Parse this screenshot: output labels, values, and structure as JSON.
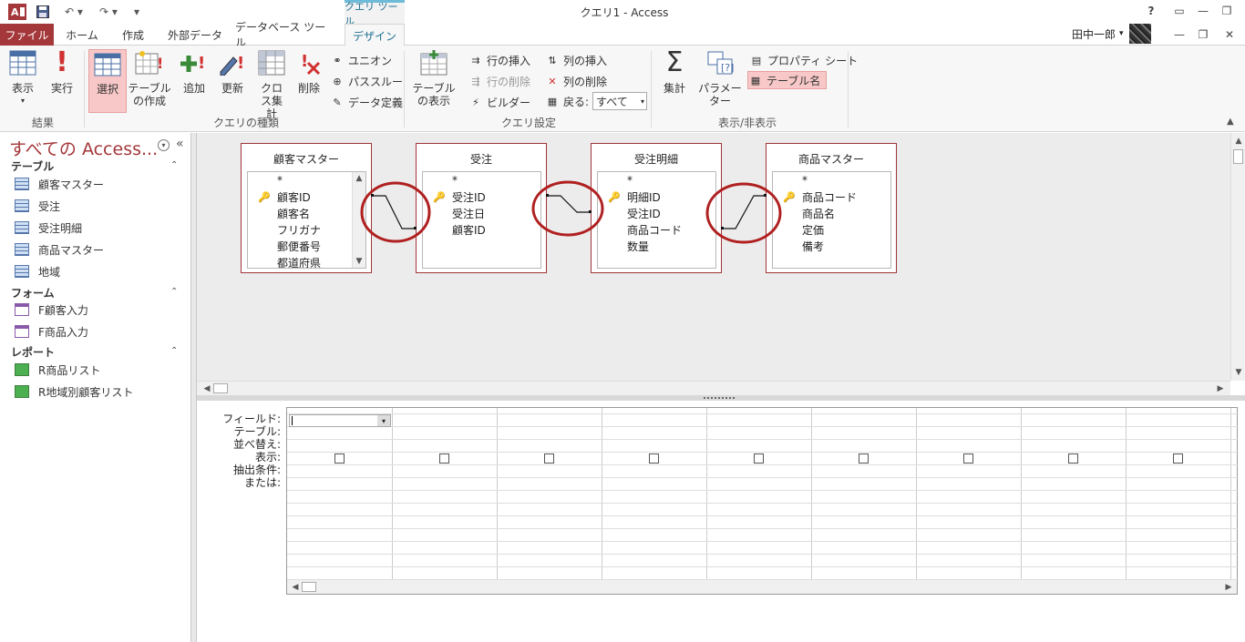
{
  "titlebar": {
    "window_title": "クエリ1 - Access",
    "context_tab_label": "クエリ ツール",
    "help": "?"
  },
  "tabs": [
    "ファイル",
    "ホーム",
    "作成",
    "外部データ",
    "データベース ツール",
    "デザイン"
  ],
  "user": {
    "name": "田中一郎"
  },
  "ribbon": {
    "results": {
      "view": "表示",
      "run": "実行",
      "group": "結果"
    },
    "query_type": {
      "select": "選択",
      "make_table": "テーブルの作成",
      "append": "追加",
      "update": "更新",
      "crosstab": "クロス集計",
      "delete": "削除",
      "union": "ユニオン",
      "passthrough": "パススルー",
      "data_definition": "データ定義",
      "group": "クエリの種類"
    },
    "query_setup": {
      "show_table": "テーブルの表示",
      "insert_rows": "行の挿入",
      "delete_rows": "行の削除",
      "builder": "ビルダー",
      "insert_columns": "列の挿入",
      "delete_columns": "列の削除",
      "return_label": "戻る:",
      "return_value": "すべて",
      "group": "クエリ設定"
    },
    "show_hide": {
      "totals": "集計",
      "parameters": "パラメーター",
      "property_sheet": "プロパティ シート",
      "table_names": "テーブル名",
      "group": "表示/非表示"
    }
  },
  "nav": {
    "title": "すべての Access...",
    "groups": [
      {
        "label": "テーブル",
        "items": [
          "顧客マスター",
          "受注",
          "受注明細",
          "商品マスター",
          "地域"
        ]
      },
      {
        "label": "フォーム",
        "items": [
          "F顧客入力",
          "F商品入力"
        ]
      },
      {
        "label": "レポート",
        "items": [
          "R商品リスト",
          "R地域別顧客リスト"
        ]
      }
    ]
  },
  "tables": [
    {
      "name": "顧客マスター",
      "fields": [
        {
          "name": "*",
          "key": false
        },
        {
          "name": "顧客ID",
          "key": true
        },
        {
          "name": "顧客名",
          "key": false
        },
        {
          "name": "フリガナ",
          "key": false
        },
        {
          "name": "郵便番号",
          "key": false
        },
        {
          "name": "都道府県",
          "key": false
        }
      ]
    },
    {
      "name": "受注",
      "fields": [
        {
          "name": "*",
          "key": false
        },
        {
          "name": "受注ID",
          "key": true
        },
        {
          "name": "受注日",
          "key": false
        },
        {
          "name": "顧客ID",
          "key": false
        }
      ]
    },
    {
      "name": "受注明細",
      "fields": [
        {
          "name": "*",
          "key": false
        },
        {
          "name": "明細ID",
          "key": true
        },
        {
          "name": "受注ID",
          "key": false
        },
        {
          "name": "商品コード",
          "key": false
        },
        {
          "name": "数量",
          "key": false
        }
      ]
    },
    {
      "name": "商品マスター",
      "fields": [
        {
          "name": "*",
          "key": false
        },
        {
          "name": "商品コード",
          "key": true
        },
        {
          "name": "商品名",
          "key": false
        },
        {
          "name": "定価",
          "key": false
        },
        {
          "name": "備考",
          "key": false
        }
      ]
    }
  ],
  "grid": {
    "row_labels": [
      "フィールド:",
      "テーブル:",
      "並べ替え:",
      "表示:",
      "抽出条件:",
      "または:"
    ],
    "columns": 9,
    "colors": {
      "annotation": "#b02020",
      "accent": "#a4373a"
    }
  }
}
